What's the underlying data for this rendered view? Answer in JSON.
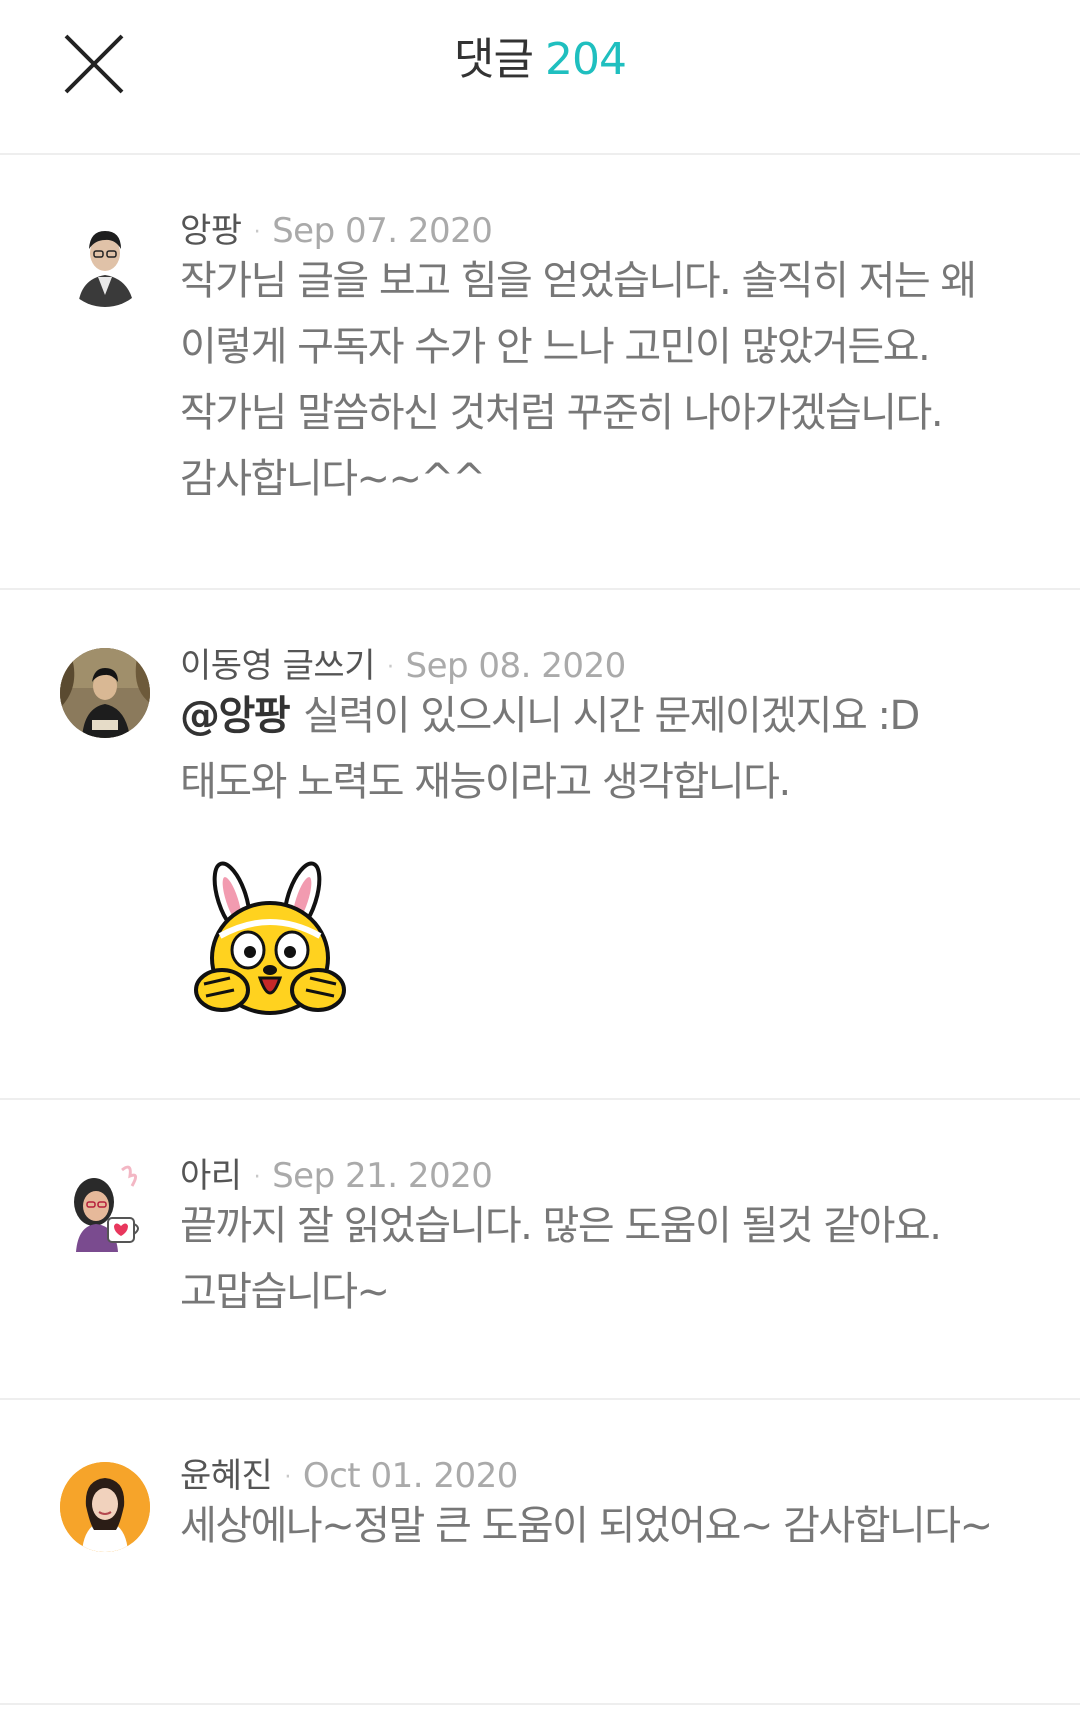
{
  "header": {
    "title": "댓글",
    "count": "204"
  },
  "icons": {
    "close": "close-icon",
    "sticker": "bunny-sticker-icon"
  },
  "colors": {
    "accent": "#1fbfbf",
    "divider": "#eeeeee",
    "text": "#777777",
    "date": "#aaaaaa"
  },
  "comments": [
    {
      "author": "앙팡",
      "separator": "·",
      "date": "Sep 07. 2020",
      "text": "작가님 글을 보고 힘을 얻었습니다. 솔직히 저는 왜 이렇게 구독자 수가 안 느나 고민이 많았거든요. 작가님 말씀하신 것처럼 꾸준히 나아가겠습니다. 감사합니다~~^^"
    },
    {
      "author": "이동영 글쓰기",
      "separator": "·",
      "date": "Sep 08. 2020",
      "mention": "@앙팡",
      "text": "실력이 있으시니 시간 문제이겠지요 :D 태도와 노력도 재능이라고 생각합니다."
    },
    {
      "author": "아리",
      "separator": "·",
      "date": "Sep 21. 2020",
      "text": "끝까지 잘 읽었습니다. 많은 도움이 될것 같아요. 고맙습니다~"
    },
    {
      "author": "윤혜진",
      "separator": "·",
      "date": "Oct 01. 2020",
      "text": "세상에나~정말 큰 도움이 되었어요~ 감사합니다~"
    }
  ]
}
